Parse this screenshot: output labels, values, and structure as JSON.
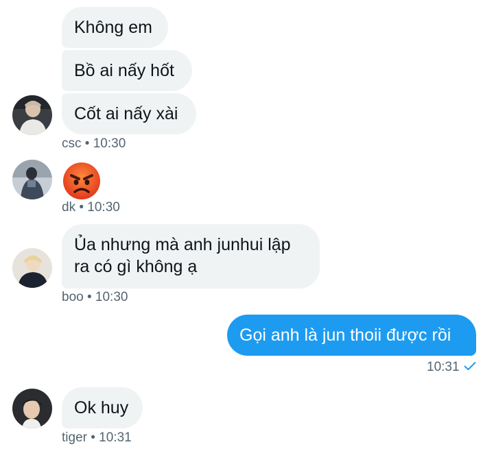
{
  "messages": [
    {
      "sender": "csc",
      "bubbles": [
        "Không em",
        "Bồ ai nấy hốt",
        "Cốt ai nấy xài"
      ],
      "meta": "csc • 10:30"
    },
    {
      "sender": "dk",
      "emoji": "angry-face",
      "meta": "dk • 10:30"
    },
    {
      "sender": "boo",
      "bubbles": [
        "Ủa nhưng mà anh junhui lập ra có gì không ạ"
      ],
      "meta": "boo • 10:30"
    },
    {
      "sender": "me",
      "bubbles": [
        "Gọi anh là jun thoii được rồi"
      ],
      "meta": "10:31",
      "status": "sent-check-icon"
    },
    {
      "sender": "tiger",
      "bubbles": [
        "Ok huy"
      ],
      "meta": "tiger • 10:31"
    }
  ],
  "colors": {
    "incoming_bubble": "#eff3f4",
    "outgoing_bubble": "#1d9bf0",
    "meta_text": "#536471",
    "accent": "#1d9bf0"
  }
}
